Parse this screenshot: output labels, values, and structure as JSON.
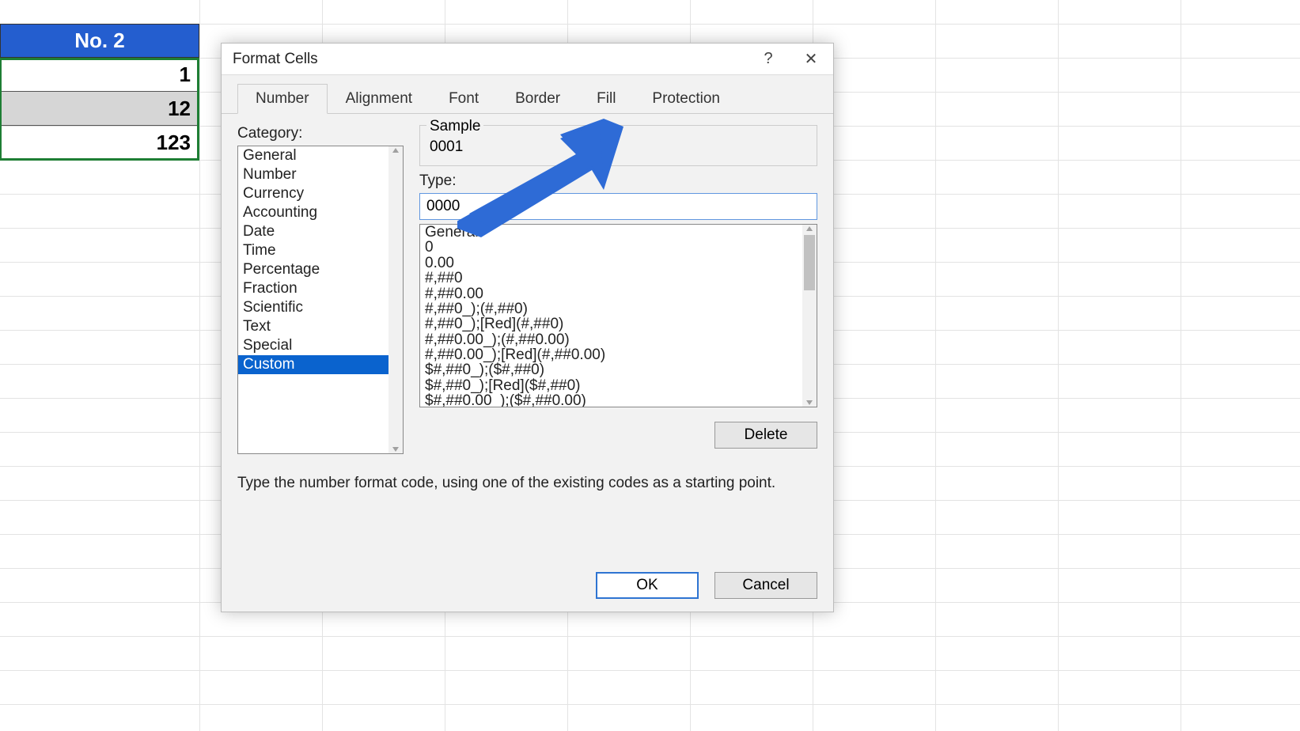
{
  "spreadsheet": {
    "header": "No. 2",
    "values": [
      "1",
      "12",
      "123"
    ]
  },
  "dialog": {
    "title": "Format Cells",
    "tabs": [
      "Number",
      "Alignment",
      "Font",
      "Border",
      "Fill",
      "Protection"
    ],
    "active_tab": 0,
    "category_label": "Category:",
    "categories": [
      "General",
      "Number",
      "Currency",
      "Accounting",
      "Date",
      "Time",
      "Percentage",
      "Fraction",
      "Scientific",
      "Text",
      "Special",
      "Custom"
    ],
    "selected_category": "Custom",
    "sample_label": "Sample",
    "sample_value": "0001",
    "type_label": "Type:",
    "type_value": "0000",
    "type_list": [
      "General",
      "0",
      "0.00",
      "#,##0",
      "#,##0.00",
      "#,##0_);(#,##0)",
      "#,##0_);[Red](#,##0)",
      "#,##0.00_);(#,##0.00)",
      "#,##0.00_);[Red](#,##0.00)",
      "$#,##0_);($#,##0)",
      "$#,##0_);[Red]($#,##0)",
      "$#,##0.00_);($#,##0.00)"
    ],
    "delete_label": "Delete",
    "hint": "Type the number format code, using one of the existing codes as a starting point.",
    "ok_label": "OK",
    "cancel_label": "Cancel"
  }
}
